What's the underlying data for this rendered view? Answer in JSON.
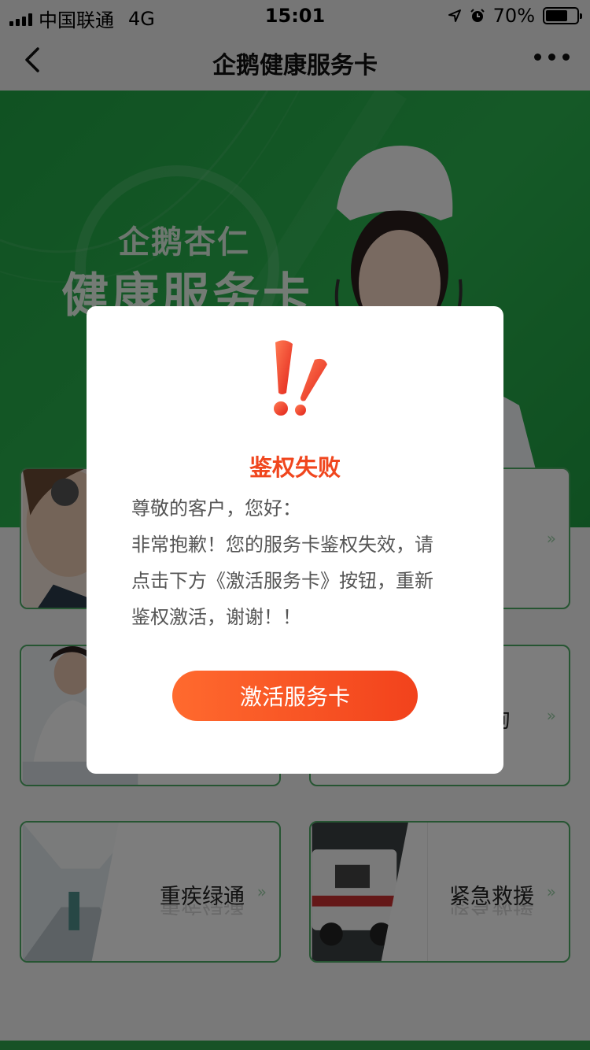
{
  "status_bar": {
    "carrier": "中国联通",
    "network": "4G",
    "time": "15:01",
    "battery": "70%",
    "battery_level": 0.7
  },
  "nav": {
    "title": "企鹅健康服务卡",
    "back_icon": "chevron-left-icon",
    "more_icon": "more-dots-icon"
  },
  "banner": {
    "line1": "企鹅杏仁",
    "line2": "健康服务卡"
  },
  "cards": [
    {
      "label": "",
      "photo": "headset-agent"
    },
    {
      "label": "",
      "photo": ""
    },
    {
      "label": "",
      "photo": "doctor"
    },
    {
      "label": "询",
      "photo": ""
    },
    {
      "label": "重疾绿通",
      "photo": "hospital-corridor"
    },
    {
      "label": "紧急救援",
      "photo": "ambulance"
    }
  ],
  "modal": {
    "icon": "exclamation-icon",
    "title": "鉴权失败",
    "body": [
      "尊敬的客户，您好：",
      "非常抱歉！您的服务卡鉴权失效，请",
      "点击下方《激活服务卡》按钮，重新",
      "鉴权激活，谢谢！！"
    ],
    "button": "激活服务卡"
  },
  "colors": {
    "brand_green": "#2bb34f",
    "alert_red": "#f0461e",
    "button_gradient_start": "#ff6a2e",
    "button_gradient_end": "#f2421c"
  }
}
